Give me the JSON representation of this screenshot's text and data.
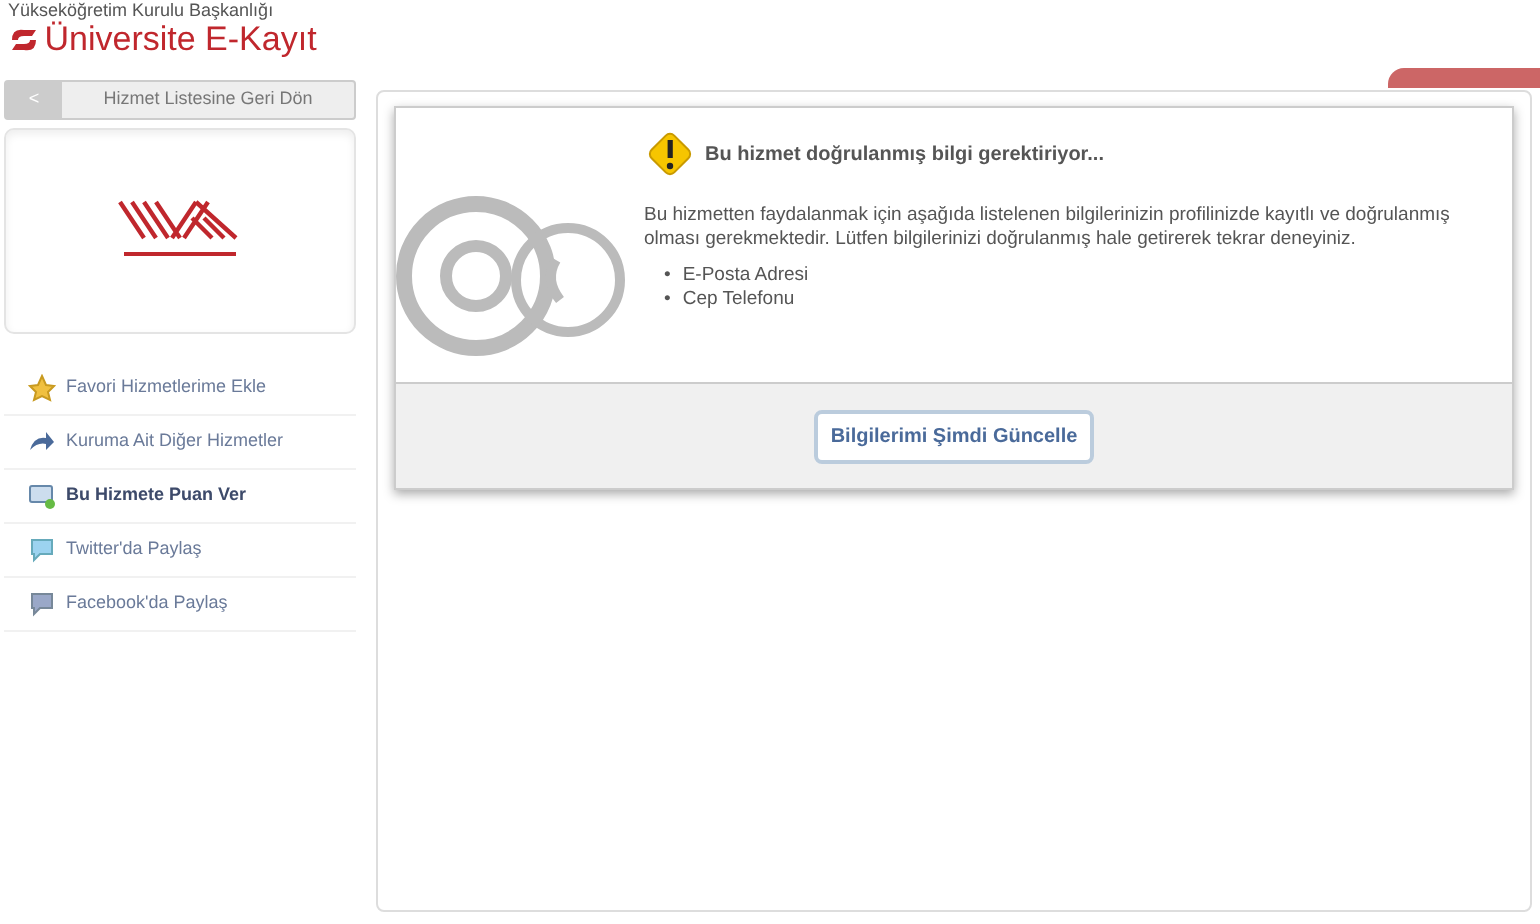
{
  "header": {
    "org": "Yükseköğretim Kurulu Başkanlığı",
    "title": "Üniversite E-Kayıt"
  },
  "back_button": {
    "arrow": "<",
    "label": "Hizmet Listesine Geri Dön"
  },
  "sidebar": {
    "items": [
      {
        "kind": "star",
        "label": "Favori Hizmetlerime Ekle",
        "selected": false
      },
      {
        "kind": "link",
        "label": "Kuruma Ait Diğer Hizmetler",
        "selected": false
      },
      {
        "kind": "rate",
        "label": "Bu Hizmete Puan Ver",
        "selected": true
      },
      {
        "kind": "twitter",
        "label": "Twitter'da Paylaş",
        "selected": false
      },
      {
        "kind": "facebook",
        "label": "Facebook'da Paylaş",
        "selected": false
      }
    ]
  },
  "dialog": {
    "title": "Bu hizmet doğrulanmış bilgi gerektiriyor...",
    "message": "Bu hizmetten faydalanmak için aşağıda listelenen bilgilerinizin profilinizde kayıtlı ve doğrulanmış olması gerekmektedir. Lütfen bilgilerinizi doğrulanmış hale getirerek tekrar deneyiniz.",
    "items": [
      {
        "bullet": "•",
        "text": "E-Posta Adresi"
      },
      {
        "bullet": "•",
        "text": "Cep Telefonu"
      }
    ],
    "button": "Bilgilerimi Şimdi Güncelle"
  }
}
